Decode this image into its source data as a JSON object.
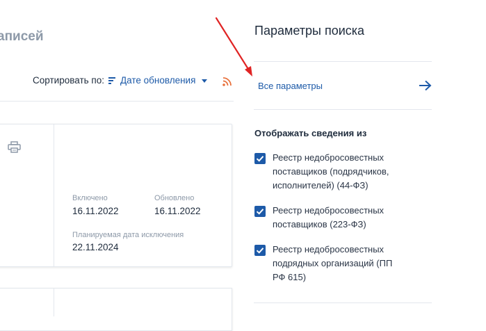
{
  "left": {
    "records_title": "аписей",
    "sort": {
      "label": "Сортировать по:",
      "value": "Дате обновления"
    },
    "card": {
      "included_label": "Включено",
      "included_value": "16.11.2022",
      "updated_label": "Обновлено",
      "updated_value": "16.11.2022",
      "planned_label": "Планируемая дата исключения",
      "planned_value": "22.11.2024"
    }
  },
  "panel": {
    "title": "Параметры поиска",
    "all_params": "Все параметры",
    "show_from": "Отображать сведения из",
    "registries": [
      {
        "label": "Реестр недобросовестных поставщиков (подрядчиков, исполнителей) (44-ФЗ)",
        "checked": true
      },
      {
        "label": "Реестр недобросовестных поставщиков (223-ФЗ)",
        "checked": true
      },
      {
        "label": "Реестр недобросовестных подрядных организаций (ПП РФ 615)",
        "checked": true
      }
    ]
  },
  "colors": {
    "accent": "#1d5aa8",
    "text": "#1e2b3c",
    "muted": "#8d99a8",
    "rss": "#e8713c",
    "annotation_arrow": "#e02424"
  },
  "icons": [
    "sort-lines-icon",
    "caret-down-icon",
    "rss-icon",
    "printer-icon",
    "arrow-right-icon",
    "checkbox-checked-icon"
  ]
}
